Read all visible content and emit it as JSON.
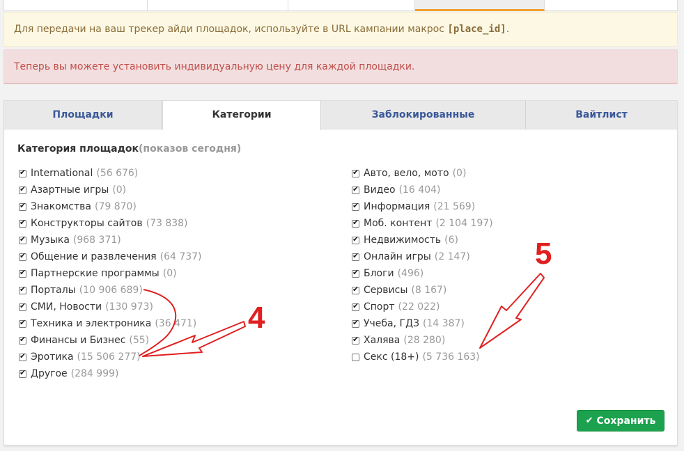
{
  "alerts": {
    "warning_text": "Для передачи на ваш трекер айди площадок, используйте в URL кампании макрос ",
    "warning_macro": "[place_id]",
    "warning_end": ".",
    "danger_text": "Теперь вы можете установить индивидуальную цену для каждой площадки."
  },
  "tabs": [
    {
      "label": "Площадки"
    },
    {
      "label": "Категории"
    },
    {
      "label": "Заблокированные"
    },
    {
      "label": "Вайтлист"
    }
  ],
  "categories": {
    "title": "Категория площадок",
    "title_suffix": "(показов сегодня)",
    "left": [
      {
        "label": "International",
        "count": "(56 676)",
        "checked": true
      },
      {
        "label": "Азартные игры",
        "count": "(0)",
        "checked": true
      },
      {
        "label": "Знакомства",
        "count": "(79 870)",
        "checked": true
      },
      {
        "label": "Конструкторы сайтов",
        "count": "(73 838)",
        "checked": true
      },
      {
        "label": "Музыка",
        "count": "(968 371)",
        "checked": true
      },
      {
        "label": "Общение и развлечения",
        "count": "(64 737)",
        "checked": true
      },
      {
        "label": "Партнерские программы",
        "count": "(0)",
        "checked": true
      },
      {
        "label": "Порталы",
        "count": "(10 906 689)",
        "checked": true
      },
      {
        "label": "СМИ, Новости",
        "count": "(130 973)",
        "checked": true
      },
      {
        "label": "Техника и электроника",
        "count": "(36 471)",
        "checked": true
      },
      {
        "label": "Финансы и Бизнес",
        "count": "(55)",
        "checked": true
      },
      {
        "label": "Эротика",
        "count": "(15 506 277)",
        "checked": true
      },
      {
        "label": "Другое",
        "count": "(284 999)",
        "checked": true
      }
    ],
    "right": [
      {
        "label": "Авто, вело, мото",
        "count": "(0)",
        "checked": true
      },
      {
        "label": "Видео",
        "count": "(16 404)",
        "checked": true
      },
      {
        "label": "Информация",
        "count": "(21 569)",
        "checked": true
      },
      {
        "label": "Моб. контент",
        "count": "(2 104 197)",
        "checked": true
      },
      {
        "label": "Недвижимость",
        "count": "(6)",
        "checked": true
      },
      {
        "label": "Онлайн игры",
        "count": "(2 147)",
        "checked": true
      },
      {
        "label": "Блоги",
        "count": "(496)",
        "checked": true
      },
      {
        "label": "Сервисы",
        "count": "(8 167)",
        "checked": true
      },
      {
        "label": "Спорт",
        "count": "(22 022)",
        "checked": true
      },
      {
        "label": "Учеба, ГДЗ",
        "count": "(14 387)",
        "checked": true
      },
      {
        "label": "Халява",
        "count": "(28 280)",
        "checked": true
      },
      {
        "label": "Секс (18+)",
        "count": "(5 736 163)",
        "checked": false
      }
    ]
  },
  "save_button": {
    "label": "Сохранить",
    "icon": "check-icon",
    "color": "#1ca24e"
  },
  "annotations": [
    {
      "number": "4",
      "color": "#e02020"
    },
    {
      "number": "5",
      "color": "#e02020"
    }
  ]
}
